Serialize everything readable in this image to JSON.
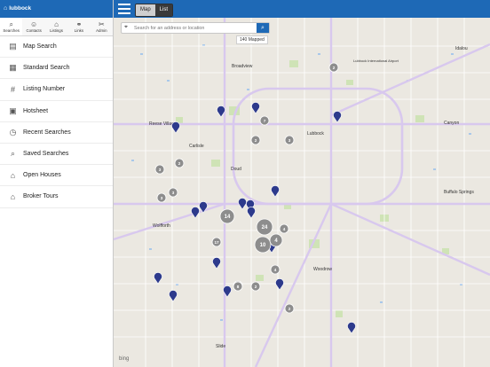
{
  "app": {
    "title": "lubbock"
  },
  "tabs": [
    {
      "label": "Searches",
      "icon": "binoculars-icon"
    },
    {
      "label": "Contacts",
      "icon": "contacts-icon"
    },
    {
      "label": "Listings",
      "icon": "listings-icon"
    },
    {
      "label": "Links",
      "icon": "link-icon"
    },
    {
      "label": "Admin",
      "icon": "tools-icon"
    }
  ],
  "menu": [
    {
      "label": "Map Search",
      "icon": "map-icon"
    },
    {
      "label": "Standard Search",
      "icon": "form-search-icon"
    },
    {
      "label": "Listing Number",
      "icon": "hash-icon"
    },
    {
      "label": "Hotsheet",
      "icon": "hotsheet-icon"
    },
    {
      "label": "Recent Searches",
      "icon": "recent-icon"
    },
    {
      "label": "Saved Searches",
      "icon": "saved-icon"
    },
    {
      "label": "Open Houses",
      "icon": "house-icon"
    },
    {
      "label": "Broker Tours",
      "icon": "tour-icon"
    }
  ],
  "toolbar": {
    "map_label": "Map",
    "list_label": "List"
  },
  "search": {
    "placeholder": "Search for an address or location"
  },
  "status": {
    "mapped_count": "140 Mapped"
  },
  "attribution": "bing",
  "map_labels": {
    "lubbock": "Lubbock",
    "reese": "Reese Village",
    "carlisle": "Carlisle",
    "wolfforth": "Wolfforth",
    "woodrow": "Woodrow",
    "slide": "Slide",
    "shallowater": "Broadview",
    "idalou": "Idalou",
    "buffalo": "Buffalo Springs",
    "canyon": "Canyon",
    "airport": "Lubbock International Airport",
    "doud": "Doud"
  },
  "clusters": [
    "2",
    "7",
    "2",
    "3",
    "3",
    "2",
    "3",
    "3",
    "14",
    "24",
    "4",
    "17",
    "10",
    "4",
    "4",
    "2",
    "2",
    "2",
    "8"
  ],
  "colors": {
    "topbar": "#1e69b6",
    "pin": "#2d3a8c",
    "cluster": "#8d8d8d"
  }
}
